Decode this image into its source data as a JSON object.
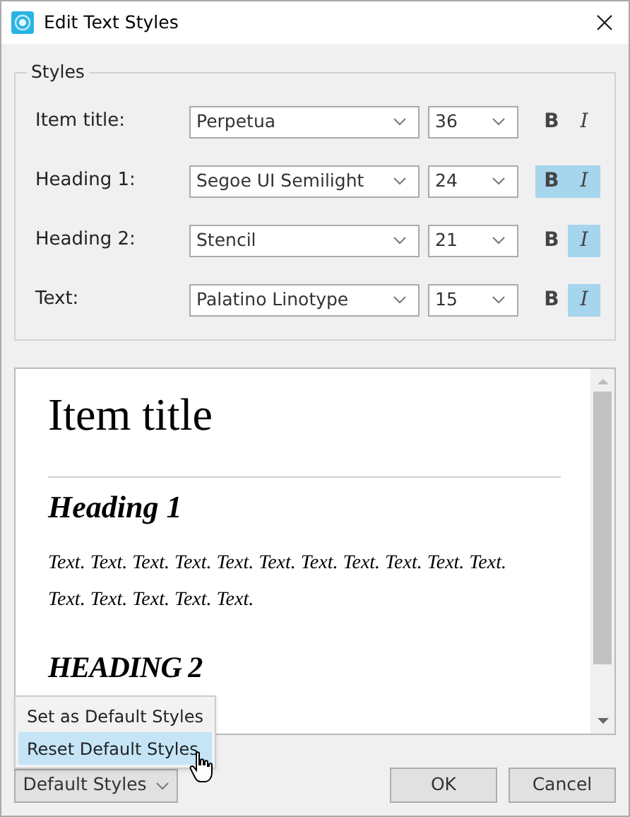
{
  "window": {
    "title": "Edit Text Styles"
  },
  "styles": {
    "title": "Styles",
    "rows": [
      {
        "label": "Item title:",
        "font": "Perpetua",
        "size": "36",
        "bold_label": "B",
        "italic_label": "I",
        "bold": false,
        "italic": false
      },
      {
        "label": "Heading 1:",
        "font": "Segoe UI Semilight",
        "size": "24",
        "bold_label": "B",
        "italic_label": "I",
        "bold": true,
        "italic": true
      },
      {
        "label": "Heading 2:",
        "font": "Stencil",
        "size": "21",
        "bold_label": "B",
        "italic_label": "I",
        "bold": false,
        "italic": true
      },
      {
        "label": "Text:",
        "font": "Palatino Linotype",
        "size": "15",
        "bold_label": "B",
        "italic_label": "I",
        "bold": false,
        "italic": true
      }
    ]
  },
  "preview": {
    "blocks": [
      {
        "kind": "title",
        "text": "Item title"
      },
      {
        "kind": "rule"
      },
      {
        "kind": "heading1",
        "text": "Heading 1"
      },
      {
        "kind": "paragraph",
        "text": "Text. Text. Text. Text. Text. Text. Text. Text. Text. Text. Text. Text. Text. Text. Text. Text."
      },
      {
        "kind": "heading2",
        "text": "HEADING 2"
      }
    ]
  },
  "menu": {
    "items": [
      {
        "label": "Set as Default Styles",
        "selected": false
      },
      {
        "label": "Reset Default Styles",
        "selected": true
      }
    ]
  },
  "buttons": {
    "default_styles": "Default Styles",
    "ok": "OK",
    "cancel": "Cancel"
  }
}
